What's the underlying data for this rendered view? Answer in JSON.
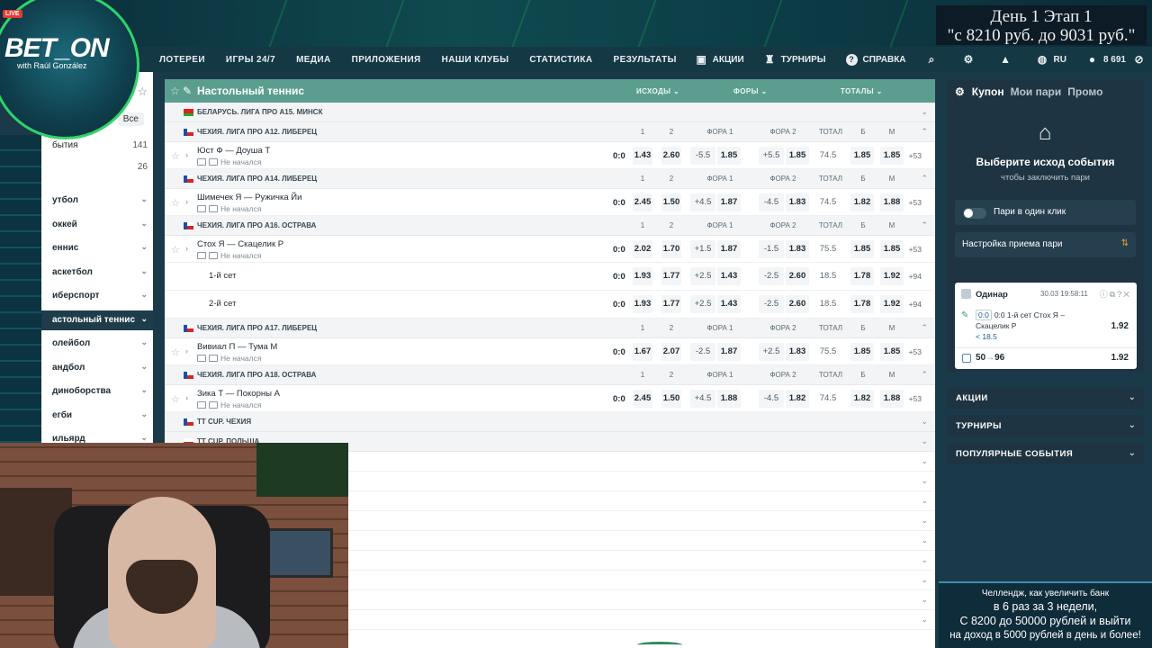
{
  "banner": {
    "stage_line1": "День 1  Этап 1",
    "stage_line2": "\"с 8210 руб. до 9031 руб.\"",
    "logo_text": "BET_ON",
    "logo_sub": "with Raúl González",
    "live_badge": "LIVE"
  },
  "nav": {
    "items": [
      "ЛОТЕРЕИ",
      "ИГРЫ 24/7",
      "МЕДИА",
      "ПРИЛОЖЕНИЯ",
      "НАШИ КЛУБЫ",
      "СТАТИСТИКА",
      "РЕЗУЛЬТАТЫ"
    ],
    "promos": "АКЦИИ",
    "tournaments": "ТУРНИРЫ",
    "help": "СПРАВКА",
    "lang": "RU",
    "balance": "8 691"
  },
  "sidebar": {
    "all_tab": "Все",
    "rows": [
      {
        "label": "бытия",
        "count": "141"
      },
      {
        "label": "",
        "count": "26"
      }
    ],
    "sports": [
      {
        "label": "утбол",
        "active": false
      },
      {
        "label": "оккей",
        "active": false
      },
      {
        "label": "еннис",
        "active": false
      },
      {
        "label": "аскетбол",
        "active": false
      },
      {
        "label": "иберспорт",
        "active": false
      },
      {
        "label": "астольный теннис",
        "active": true
      },
      {
        "label": "олейбол",
        "active": false
      },
      {
        "label": "андбол",
        "active": false
      },
      {
        "label": "диноборства",
        "active": false
      },
      {
        "label": "егби",
        "active": false
      },
      {
        "label": "ильярд",
        "active": false
      }
    ]
  },
  "main": {
    "title": "Настольный теннис",
    "col_outcomes": "ИСХОДЫ",
    "col_handicaps": "ФОРЫ",
    "col_totals": "ТОТАЛЫ",
    "sub_headers": [
      "1",
      "2",
      "ФОРА 1",
      "ФОРА 2",
      "ТОТАЛ",
      "Б",
      "М"
    ],
    "not_started": "Не начался",
    "leagues": [
      {
        "name": "БЕЛАРУСЬ. ЛИГА ПРО А15. МИНСК",
        "country": "by",
        "expanded": false,
        "events": []
      },
      {
        "name": "ЧЕХИЯ. ЛИГА ПРО А12. ЛИБЕРЕЦ",
        "country": "cz",
        "expanded": true,
        "events": [
          {
            "teams": "Юст Ф — Доуша Т",
            "score": "0:0",
            "o1": "1.43",
            "o2": "2.60",
            "h1": "-5.5",
            "h1o": "1.85",
            "h2": "+5.5",
            "h2o": "1.85",
            "t": "74.5",
            "tb": "1.85",
            "tm": "1.85",
            "more": "+53"
          }
        ]
      },
      {
        "name": "ЧЕХИЯ. ЛИГА ПРО А14. ЛИБЕРЕЦ",
        "country": "cz",
        "expanded": true,
        "events": [
          {
            "teams": "Шимечек Я — Ружичка Йи",
            "score": "0:0",
            "o1": "2.45",
            "o2": "1.50",
            "h1": "+4.5",
            "h1o": "1.87",
            "h2": "-4.5",
            "h2o": "1.83",
            "t": "74.5",
            "tb": "1.82",
            "tm": "1.88",
            "more": "+53"
          }
        ]
      },
      {
        "name": "ЧЕХИЯ. ЛИГА ПРО А16. ОСТРАВА",
        "country": "cz",
        "expanded": true,
        "events": [
          {
            "teams": "Стох Я — Скацелик Р",
            "score": "0:0",
            "o1": "2.02",
            "o2": "1.70",
            "h1": "+1.5",
            "h1o": "1.87",
            "h2": "-1.5",
            "h2o": "1.83",
            "t": "75.5",
            "tb": "1.85",
            "tm": "1.85",
            "more": "+53"
          },
          {
            "set": "1-й сет",
            "score": "0:0",
            "o1": "1.93",
            "o2": "1.77",
            "h1": "+2.5",
            "h1o": "1.43",
            "h2": "-2.5",
            "h2o": "2.60",
            "t": "18.5",
            "tb": "1.78",
            "tm": "1.92",
            "more": "+94"
          },
          {
            "set": "2-й сет",
            "score": "0:0",
            "o1": "1.93",
            "o2": "1.77",
            "h1": "+2.5",
            "h1o": "1.43",
            "h2": "-2.5",
            "h2o": "2.60",
            "t": "18.5",
            "tb": "1.78",
            "tm": "1.92",
            "more": "+94"
          }
        ]
      },
      {
        "name": "ЧЕХИЯ. ЛИГА ПРО А17. ЛИБЕРЕЦ",
        "country": "cz",
        "expanded": true,
        "events": [
          {
            "teams": "Вивиал П — Тума М",
            "score": "0:0",
            "o1": "1.67",
            "o2": "2.07",
            "h1": "-2.5",
            "h1o": "1.87",
            "h2": "+2.5",
            "h2o": "1.83",
            "t": "75.5",
            "tb": "1.85",
            "tm": "1.85",
            "more": "+53"
          }
        ]
      },
      {
        "name": "ЧЕХИЯ. ЛИГА ПРО А18. ОСТРАВА",
        "country": "cz",
        "expanded": true,
        "events": [
          {
            "teams": "Зика Т — Покорны А",
            "score": "0:0",
            "o1": "2.45",
            "o2": "1.50",
            "h1": "+4.5",
            "h1o": "1.88",
            "h2": "-4.5",
            "h2o": "1.82",
            "t": "74.5",
            "tb": "1.82",
            "tm": "1.88",
            "more": "+53"
          }
        ]
      },
      {
        "name": "TT CUP. ЧЕХИЯ",
        "country": "cz",
        "expanded": false,
        "events": []
      },
      {
        "name": "TT CUP. ПОЛЬША",
        "country": "pl",
        "expanded": false,
        "events": []
      }
    ]
  },
  "coupon": {
    "tab_coupon": "Купон",
    "tab_my_bets": "Мои пари",
    "tab_promo": "Промо",
    "choose_title": "Выберите исход события",
    "choose_sub": "чтобы заключить пари",
    "one_click": "Пари в один клик",
    "settings": "Настройка приема пари",
    "bet": {
      "type": "Одинар",
      "time": "30.03 19:58:11",
      "score": "0:0",
      "selection": "0:0 1-й сет Стох Я – Скацелик Р",
      "line": "< 18.5",
      "odd": "1.92",
      "stake_from": "50",
      "stake_to": "96",
      "total_odd": "1.92"
    }
  },
  "accordions": [
    "АКЦИИ",
    "ТУРНИРЫ",
    "ПОПУЛЯРНЫЕ СОБЫТИЯ"
  ],
  "promo": {
    "line1": "Челлендж, как увеличить банк",
    "line2": "в 6 раз за 3 недели,",
    "line3": "С 8200 до 50000 рублей и выйти",
    "line4": "на доход в 5000 рублей в день и более!"
  },
  "colors": {
    "header_green": "#5b9e8f",
    "coupon_dark": "#1f3442",
    "nav_dark": "#153845",
    "accent_green": "#2fd36a"
  }
}
